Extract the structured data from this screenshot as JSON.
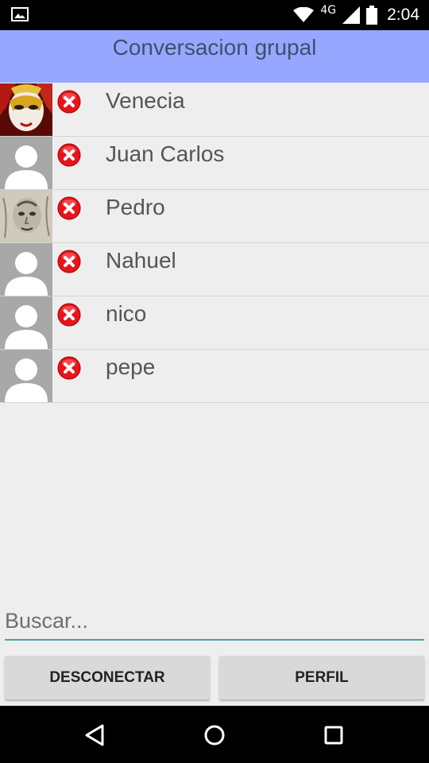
{
  "status_bar": {
    "network_label": "4G",
    "time": "2:04",
    "icons": [
      "gallery-icon",
      "wifi-icon",
      "signal-icon",
      "battery-icon"
    ]
  },
  "header": {
    "title": "Conversacion grupal",
    "background_color": "#97a7ff"
  },
  "contacts": [
    {
      "name": "Venecia",
      "avatar": "venetian-mask-photo"
    },
    {
      "name": "Juan Carlos",
      "avatar": "default-person-avatar"
    },
    {
      "name": "Pedro",
      "avatar": "sketch-face-photo"
    },
    {
      "name": "Nahuel",
      "avatar": "default-person-avatar"
    },
    {
      "name": "nico",
      "avatar": "default-person-avatar"
    },
    {
      "name": "pepe",
      "avatar": "default-person-avatar"
    }
  ],
  "search": {
    "placeholder": "Buscar...",
    "value": ""
  },
  "buttons": {
    "disconnect_label": "DESCONECTAR",
    "profile_label": "PERFIL"
  },
  "nav_bar": {
    "icons": [
      "back-icon",
      "home-icon",
      "recents-icon"
    ]
  },
  "colors": {
    "remove_icon": "#e8141c",
    "search_underline": "#4a9fa3"
  }
}
